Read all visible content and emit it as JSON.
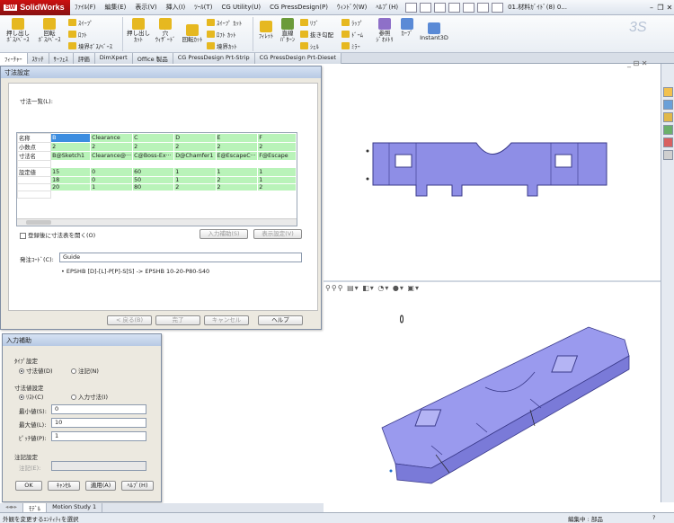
{
  "app": {
    "logo_text": "SolidWorks",
    "logo_badge": "SW",
    "title": "01.材料ｶﾞｲﾄﾞ(8) 0..."
  },
  "menu": [
    "ﾌｧｲﾙ(F)",
    "編集(E)",
    "表示(V)",
    "挿入(I)",
    "ﾂｰﾙ(T)",
    "CG Utility(U)",
    "CG PressDesign(P)",
    "ｳｨﾝﾄﾞｳ(W)",
    "ﾍﾙﾌﾟ(H)"
  ],
  "ribbon": {
    "extrude_boss": "押し出し\nﾎﾞｽ/ﾍﾞｰｽ",
    "revolve_boss": "回転\nﾎﾞｽ/ﾍﾞｰｽ",
    "sweep": "ｽｲｰﾌﾟ",
    "loft": "ﾛﾌﾄ",
    "boundary_boss": "境界ﾎﾞｽ/ﾍﾞｰｽ",
    "extrude_cut": "押し出し\nｶｯﾄ",
    "hole_wizard": "穴\nｳｨｻﾞｰﾄﾞ",
    "revolve_cut": "回転ｶｯﾄ",
    "sweep_cut": "ｽｲｰﾌﾟ ｶｯﾄ",
    "loft_cut": "ﾛﾌﾄ ｶｯﾄ",
    "boundary_cut": "境界ｶｯﾄ",
    "fillet": "ﾌｨﾚｯﾄ",
    "linear_pattern": "直線\nﾊﾟﾀｰﾝ",
    "rib": "ﾘﾌﾞ",
    "draft": "抜き勾配",
    "shell": "ｼｪﾙ",
    "wrap": "ﾗｯﾌﾟ",
    "dome": "ﾄﾞｰﾑ",
    "mirror": "ﾐﾗｰ",
    "ref_geometry": "参照\nｼﾞｵﾒﾄﾘ",
    "curves": "ｶｰﾌﾞ",
    "instant3d": "Instant3D"
  },
  "tabs": [
    {
      "label": "ﾌｨｰﾁｬｰ",
      "active": true
    },
    {
      "label": "ｽｹｯﾁ"
    },
    {
      "label": "ｻｰﾌｪｽ"
    },
    {
      "label": "評価"
    },
    {
      "label": "DimXpert"
    },
    {
      "label": "Office 製品"
    },
    {
      "label": "CG PressDesign Prt-Strip"
    },
    {
      "label": "CG PressDesign Prt-Dieset"
    }
  ],
  "dim_dialog": {
    "title": "寸法設定",
    "list_label": "寸法一覧(L):",
    "row_headers": [
      "名称",
      "小数点",
      "寸法名",
      "",
      "設定値",
      "",
      "",
      ""
    ],
    "columns": [
      {
        "name": "B",
        "decimals": "2",
        "dimname": "B@Sketch1",
        "values": [
          "15",
          "18",
          "20"
        ]
      },
      {
        "name": "Clearance",
        "decimals": "2",
        "dimname": "Clearance@···",
        "values": [
          "0",
          "0",
          "1"
        ]
      },
      {
        "name": "C",
        "decimals": "2",
        "dimname": "C@Boss-Ex···",
        "values": [
          "60",
          "50",
          "80"
        ]
      },
      {
        "name": "D",
        "decimals": "2",
        "dimname": "D@Chamfer1",
        "values": [
          "1",
          "1",
          "2"
        ]
      },
      {
        "name": "E",
        "decimals": "2",
        "dimname": "E@EscapeC···",
        "values": [
          "1",
          "2",
          "2"
        ]
      },
      {
        "name": "F",
        "decimals": "2",
        "dimname": "F@Escape",
        "values": [
          "1",
          "1",
          "2"
        ]
      }
    ],
    "chk_open_table": "登録後に寸法表を開く(O)",
    "btn_input_assist": "入力補助(S)",
    "btn_display_settings": "表示設定(V)",
    "order_code_label": "発注ｺｰﾄﾞ(C):",
    "order_code_value": "Guide",
    "order_code_example": "EPSHB [D]-[L]-P[P]-S[S] -> EPSHB 10-20-P80-S40",
    "btn_back": "< 戻る(B)",
    "btn_finish": "完了",
    "btn_cancel": "キャンセル",
    "btn_help": "ヘルプ"
  },
  "assist_dialog": {
    "title": "入力補助",
    "type_group": "ﾀｲﾌﾟ設定",
    "type_dim": "寸法値(D)",
    "type_note": "注記(N)",
    "value_group": "寸法値設定",
    "val_list": "ﾘｽﾄ(C)",
    "val_input": "入力寸法(I)",
    "min_label": "最小値(S):",
    "min_value": "0",
    "max_label": "最大値(L):",
    "max_value": "10",
    "pitch_label": "ﾋﾟｯﾁ値(P):",
    "pitch_value": "1",
    "note_group": "注記設定",
    "note_label": "注記(E):",
    "note_value": "",
    "btn_ok": "OK",
    "btn_cancel": "ｷｬﾝｾﾙ",
    "btn_apply": "適用(A)",
    "btn_help": "ﾍﾙﾌﾟ(H)"
  },
  "bottom_tabs": [
    "ﾓﾃﾞﾙ",
    "Motion Study 1"
  ],
  "status": {
    "left": "外観を変更するｴﾝﾃｨﾃｨを選択",
    "right": "編集中 : 部品"
  },
  "colors": {
    "part_fill": "#8e8ee6",
    "part_edge": "#3a3a8a",
    "highlight": "#3c8de0",
    "grid_green": "#b9f3b9"
  }
}
